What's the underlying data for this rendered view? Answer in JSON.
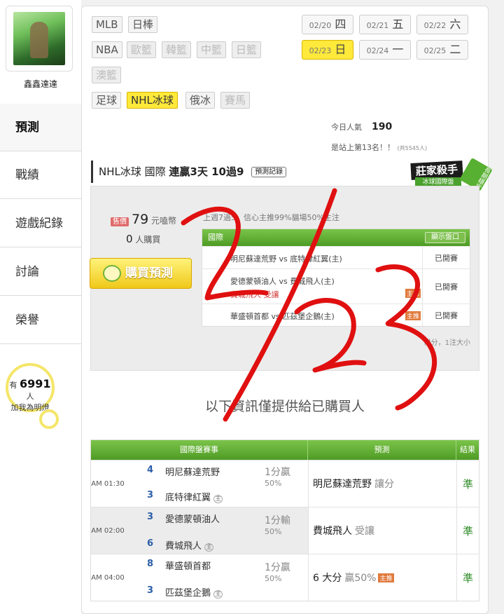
{
  "sidebar": {
    "username": "鑫鑫達達",
    "items": [
      {
        "label": "預測",
        "active": true
      },
      {
        "label": "戰績"
      },
      {
        "label": "遊戲紀錄"
      },
      {
        "label": "討論"
      },
      {
        "label": "榮譽"
      }
    ],
    "fan_prefix": "有",
    "fan_count": "6991",
    "fan_unit": "人",
    "fan_cta": "加我為明燈"
  },
  "leagues": {
    "row1": [
      "MLB",
      "日棒"
    ],
    "row2": [
      "NBA",
      "歐籃",
      "韓籃",
      "中籃",
      "日籃"
    ],
    "row3": [
      "澳籃"
    ],
    "row4": [
      "足球",
      "NHL冰球",
      "俄冰",
      "賽馬"
    ]
  },
  "dates": [
    {
      "md": "02/20",
      "wd": "四"
    },
    {
      "md": "02/21",
      "wd": "五"
    },
    {
      "md": "02/22",
      "wd": "六"
    },
    {
      "md": "02/23",
      "wd": "日",
      "selected": true
    },
    {
      "md": "02/24",
      "wd": "一"
    },
    {
      "md": "02/25",
      "wd": "二"
    }
  ],
  "popularity": {
    "today_label": "今日人氣",
    "today_value": "190",
    "rank_text": "是站上第13名！！",
    "rank_sub": "(共5545人)"
  },
  "title_bar": {
    "text": "NHL冰球 國際",
    "streak": "連贏3天 10過9",
    "record_button": "預測記錄"
  },
  "badge": {
    "main": "莊家殺手",
    "sub": "冰球國際盤",
    "ribbon": "長期穩定"
  },
  "purchase": {
    "price_label": "售價",
    "price": "79",
    "price_unit": "元嗑幣",
    "buyers": "0",
    "buyers_unit": "人購買",
    "buy_button": "購買預測",
    "summary": "上週7過5，信心主推99%貓場50%主注",
    "table_head": "國際",
    "show_button": "顯示盤口",
    "rows": [
      {
        "text": "明尼蘇達荒野 vs 底特律紅翼(主)",
        "status": "已開賽"
      },
      {
        "text": "愛德蒙頓油人 vs 費城飛人(主)",
        "status": "已開賽",
        "sub": "費城飛人 受讓",
        "pill": "主推"
      },
      {
        "text": "華盛頓首都 vs 匹茲堡企鵝(主)",
        "status": "已開賽",
        "pill": "主推"
      }
    ],
    "note": "貓分，1注大小"
  },
  "notice": "以下資訊僅提供給已購買人",
  "results": {
    "headers": [
      "國際盤賽事",
      "預測",
      "結果"
    ],
    "rows": [
      {
        "time": "AM 01:30",
        "away_score": "4",
        "away": "明尼蘇達荒野",
        "home_score": "3",
        "home": "底特律紅翼",
        "home_mark": "主",
        "odds": "1分贏",
        "odds2": "50%",
        "pick": "明尼蘇達荒野",
        "pick_note": "讓分",
        "pill": "",
        "result": "準"
      },
      {
        "time": "AM 02:00",
        "away_score": "3",
        "away": "愛德蒙頓油人",
        "home_score": "6",
        "home": "費城飛人",
        "home_mark": "主",
        "odds": "1分輸",
        "odds2": "50%",
        "pick": "費城飛人",
        "pick_note": "受讓",
        "pill": "",
        "result": "準"
      },
      {
        "time": "AM 04:00",
        "away_score": "8",
        "away": "華盛頓首都",
        "home_score": "3",
        "home": "匹茲堡企鵝",
        "home_mark": "主",
        "odds": "1分贏",
        "odds2": "50%",
        "pick": "6 大分",
        "pick_note": "贏50%",
        "pill": "主推",
        "result": "準"
      }
    ]
  },
  "annotation": {
    "handwritten": "2/23",
    "color": "#e01010"
  }
}
